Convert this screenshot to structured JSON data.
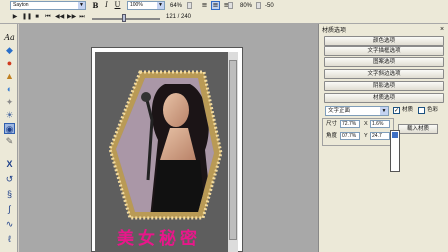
{
  "toolbar": {
    "font_name": "Sayton",
    "bold": "B",
    "italic": "I",
    "underline": "U",
    "zoom": "100%",
    "scale_a": "64%",
    "scale_b": "80%",
    "rotation": "-50",
    "frame_counter": "121 / 240"
  },
  "tools": {
    "text_tool": "Aa",
    "x_tool": "X"
  },
  "canvas": {
    "caption": "美女秘密"
  },
  "panel": {
    "title": "材质选项",
    "close": "×",
    "buttons": [
      "颜色选项",
      "文字描框选项",
      "图案选项",
      "文字斜边选项",
      "阴影选项",
      "材质选项"
    ],
    "select_value": "文字正面",
    "chk_material_label": "材质",
    "chk_color_label": "色彩",
    "size_label": "尺寸",
    "x_label": "X",
    "x_value": "1.6%",
    "size_value": "72.7%",
    "angle_label": "角度",
    "angle_value": "07.7%",
    "y_label": "Y",
    "y_value": "24.7",
    "load_button": "载入材质"
  }
}
